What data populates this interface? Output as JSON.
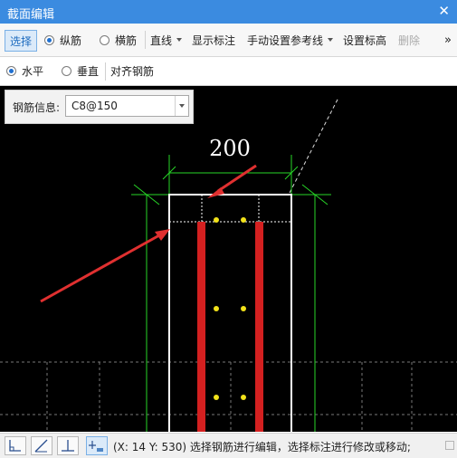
{
  "window": {
    "title": "截面编辑",
    "close_glyph": "✕"
  },
  "toolbar": {
    "select_label": "选择",
    "longitudinal_label": "纵筋",
    "transverse_label": "横筋",
    "line_label": "直线",
    "show_dimension_label": "显示标注",
    "manual_reference_label": "手动设置参考线",
    "set_elevation_label": "设置标高",
    "delete_label": "删除",
    "overflow_glyph": "»",
    "selected_radio": "纵筋"
  },
  "toolbar2": {
    "horizontal_label": "水平",
    "vertical_label": "垂直",
    "align_label": "对齐钢筋",
    "selected_radio": "水平"
  },
  "rebar_info": {
    "label": "钢筋信息:",
    "value": "C8@150"
  },
  "drawing": {
    "dimension_text": "200"
  },
  "status": {
    "text": "(X: 14 Y: 530)  选择钢筋进行编辑，选择标注进行修改或移动;"
  },
  "colors": {
    "titlebar": "#3b8be0",
    "canvas_bg": "#000000",
    "rebar_red": "#d42020",
    "arrow_red": "#e03030",
    "dimension_green": "#27d627",
    "section_outline": "#ffffff",
    "rebar_point": "#f2e21a"
  },
  "icons": {
    "status_buttons": [
      "orthogonal-icon",
      "oblique-line-icon",
      "perpendicular-icon",
      "point-snap-icon"
    ],
    "combo_arrow": "dropdown-arrow-icon"
  }
}
